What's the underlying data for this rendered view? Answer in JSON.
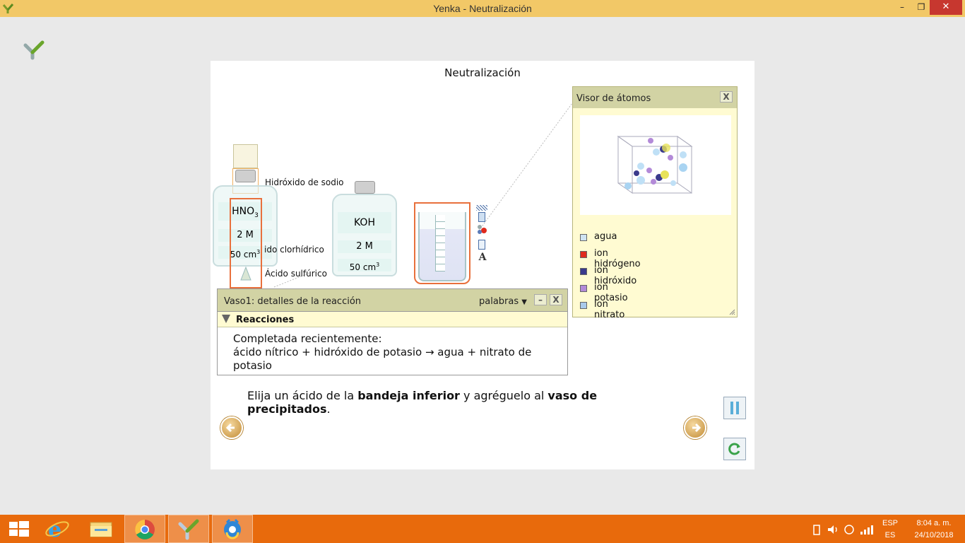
{
  "window": {
    "title": "Yenka - Neutralización",
    "minimize": "–",
    "restore": "❐",
    "close": "✕"
  },
  "panel": {
    "title": "Neutralización"
  },
  "bench": {
    "label_sodium_hydroxide": "Hidróxido de sodio",
    "label_hydrochloric": "Ácido clorhídrico",
    "label_hydrochloric_visible": "ido clorhídrico",
    "label_sulfuric": "Ácido sulfúrico",
    "bottle1": {
      "formula": "HNO",
      "formula_sub": "3",
      "conc": "2 M",
      "volume": "50 cm",
      "volume_sup": "3"
    },
    "bottle2": {
      "formula": "KOH",
      "conc": "2 M",
      "volume": "50 cm",
      "volume_sup": "3"
    },
    "tool_text_icon": "A"
  },
  "atom_viewer": {
    "title": "Visor de átomos",
    "close": "X",
    "legend": [
      {
        "label": "agua",
        "color": "#cfe3f2"
      },
      {
        "label": "ion hidrógeno",
        "color": "#e02a1d"
      },
      {
        "label": "ion hidróxido",
        "color": "#3a3a8c"
      },
      {
        "label": "ion potasio",
        "color": "#b38ad8"
      },
      {
        "label": "ion nitrato",
        "color": "#a9c9ea"
      }
    ]
  },
  "details": {
    "title": "Vaso1: detalles de la reacción",
    "view_select": "palabras",
    "minimize": "–",
    "close": "X",
    "section": "Reacciones",
    "line1": "Completada recientemente:",
    "line2": "ácido nítrico + hidróxido de potasio → agua + nitrato de potasio"
  },
  "instruction": {
    "p1": "Elija un ácido de la ",
    "b1": "bandeja inferior",
    "p2": " y agréguelo al ",
    "b2": "vaso de precipitados",
    "p3": "."
  },
  "taskbar": {
    "lang_top": "ESP",
    "lang_bottom": "ES",
    "time": "8:04 a. m.",
    "date": "24/10/2018"
  }
}
